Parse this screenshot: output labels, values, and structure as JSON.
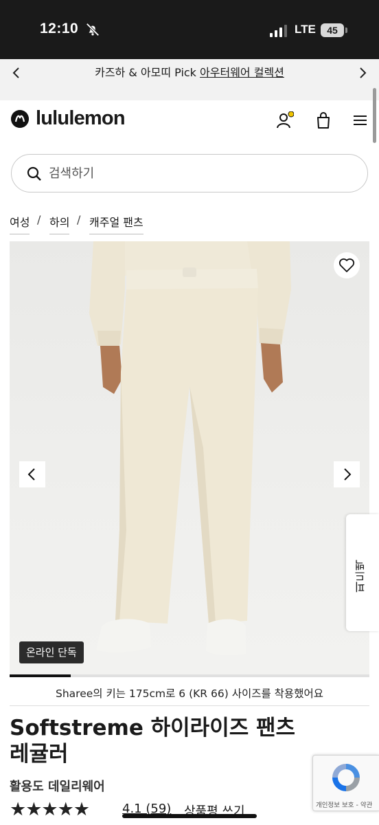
{
  "status_bar": {
    "time": "12:10",
    "network": "LTE",
    "battery": "45"
  },
  "promo": {
    "prefix": "카즈하 & 아모띠 Pick ",
    "link": "아우터웨어 컬렉션"
  },
  "header": {
    "brand": "lululemon"
  },
  "search": {
    "placeholder": "검색하기"
  },
  "breadcrumb": [
    "여성",
    "하의",
    "캐주얼 팬츠"
  ],
  "hero": {
    "badge": "온라인 단독",
    "progress": 0.17
  },
  "feedback": {
    "label": "피드백"
  },
  "product": {
    "size_note": "Sharee의 키는 175cm로 6 (KR 66) 사이즈를 착용했어요",
    "title": "Softstreme 하이라이즈 팬츠 레귤러",
    "subtitle": "활용도 데일리웨어",
    "stars": "★★★★★",
    "rating": 4.1,
    "rating_text": "4.1 (59)",
    "review_link": "상품평 쓰기"
  },
  "recaptcha": {
    "label": "개인정보 보호 - 약관"
  },
  "colors": {
    "dark": "#1a1a1a",
    "accent_dot": "#f0c400",
    "recaptcha_blue": "#4a90e2"
  }
}
